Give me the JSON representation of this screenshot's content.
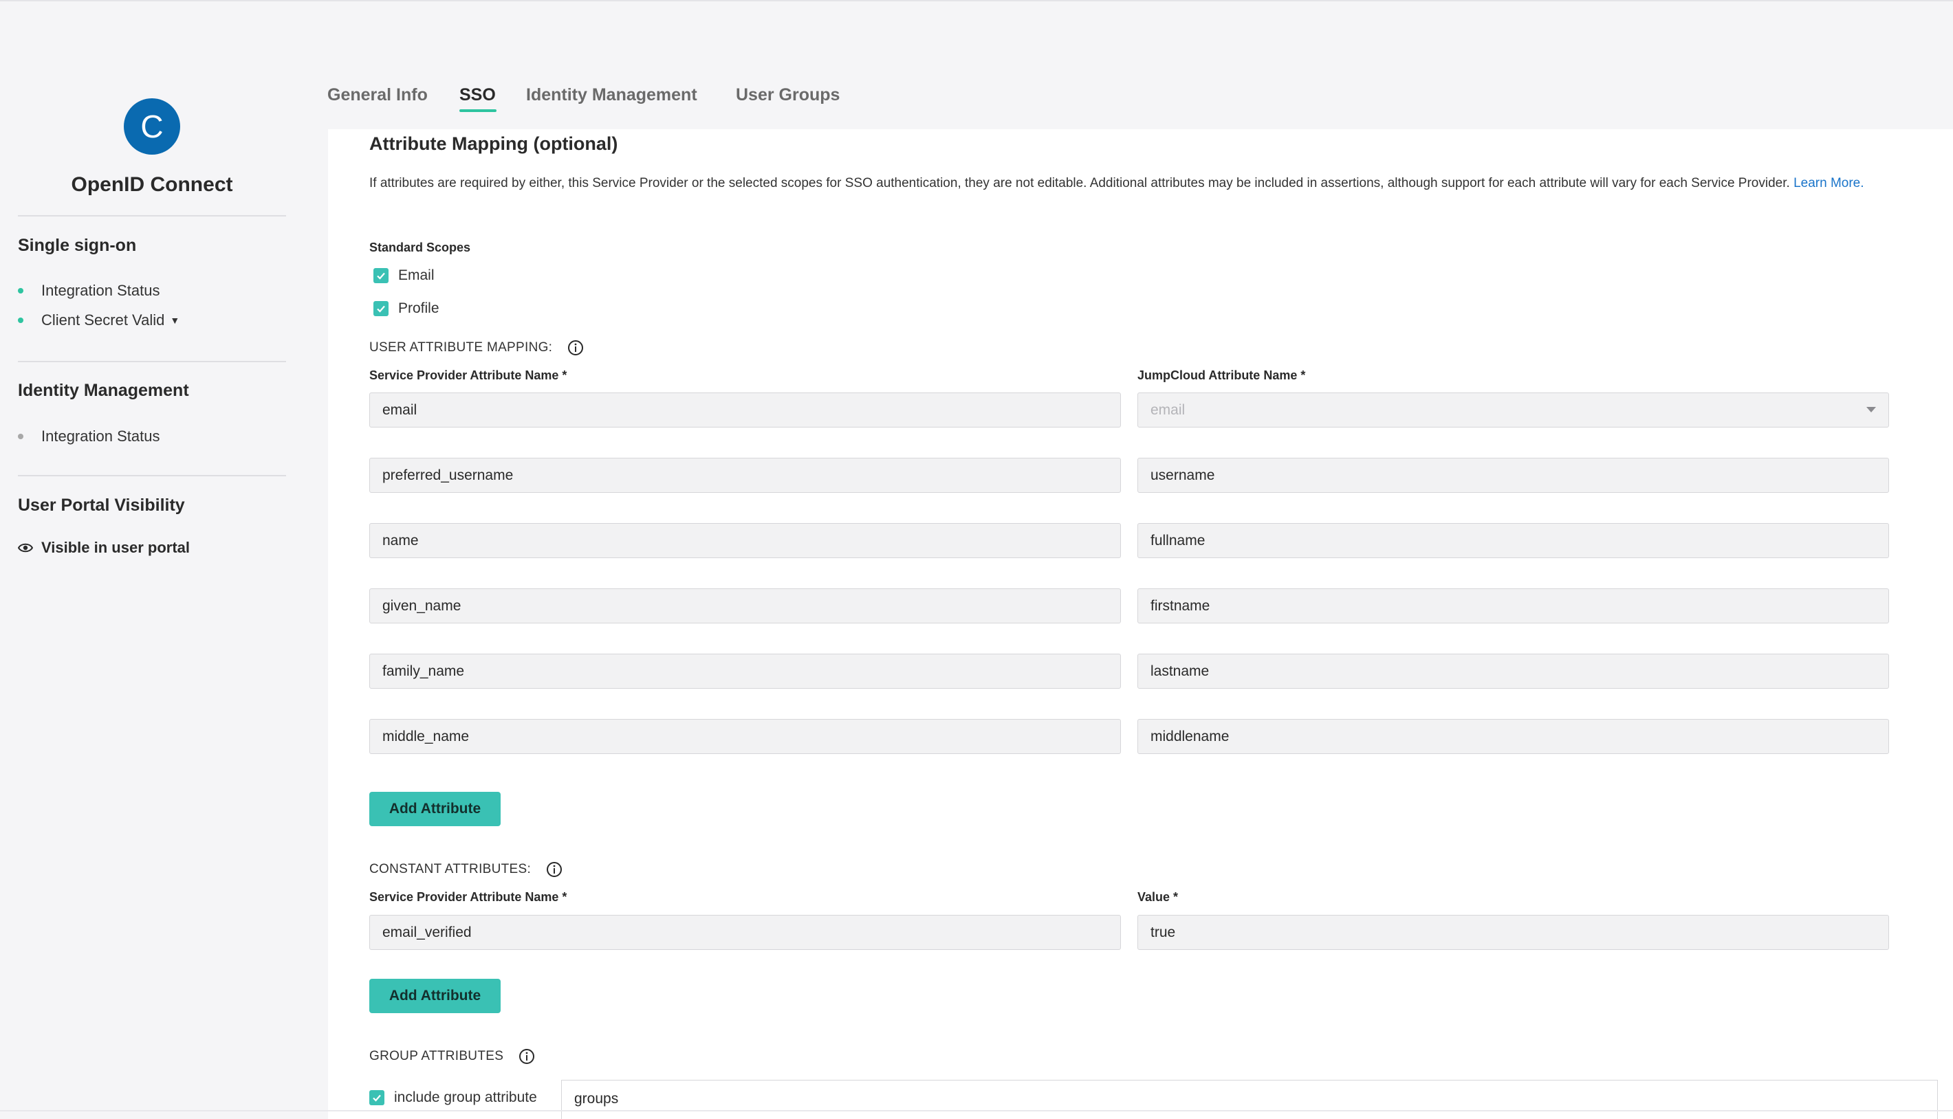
{
  "app": {
    "logo_letter": "C",
    "name": "OpenID Connect"
  },
  "sidebar": {
    "sso_title": "Single sign-on",
    "sso_items": [
      {
        "label": "Integration Status",
        "status": "green"
      },
      {
        "label": "Client Secret Valid",
        "status": "green"
      }
    ],
    "idm_title": "Identity Management",
    "idm_items": [
      {
        "label": "Integration Status",
        "status": "grey"
      }
    ],
    "portal_title": "User Portal Visibility",
    "portal_item": "Visible in user portal"
  },
  "tabs": [
    {
      "label": "General Info",
      "active": false
    },
    {
      "label": "SSO",
      "active": true
    },
    {
      "label": "Identity Management",
      "active": false
    },
    {
      "label": "User Groups",
      "active": false
    }
  ],
  "attribute_mapping": {
    "title": "Attribute Mapping (optional)",
    "description": "If attributes are required by either, this Service Provider or the selected scopes for SSO authentication, they are not editable. Additional attributes may be included in assertions, although support for each attribute will vary for each Service Provider.",
    "learn_more": "Learn More.",
    "standard_scopes_label": "Standard Scopes",
    "scopes": [
      {
        "label": "Email",
        "checked": true
      },
      {
        "label": "Profile",
        "checked": true
      }
    ],
    "user_mapping_label": "USER ATTRIBUTE MAPPING:",
    "sp_header": "Service Provider Attribute Name *",
    "jc_header": "JumpCloud Attribute Name *",
    "rows": [
      {
        "sp": "email",
        "jc": "email"
      },
      {
        "sp": "preferred_username",
        "jc": "username"
      },
      {
        "sp": "name",
        "jc": "fullname"
      },
      {
        "sp": "given_name",
        "jc": "firstname"
      },
      {
        "sp": "family_name",
        "jc": "lastname"
      },
      {
        "sp": "middle_name",
        "jc": "middlename"
      }
    ],
    "add_attribute": "Add Attribute"
  },
  "constant_attributes": {
    "label": "CONSTANT ATTRIBUTES:",
    "sp_header": "Service Provider Attribute Name *",
    "value_header": "Value *",
    "row": {
      "sp": "email_verified",
      "value": "true"
    },
    "add_attribute": "Add Attribute"
  },
  "group_attributes": {
    "label": "GROUP ATTRIBUTES",
    "include_label": "include group attribute",
    "include_checked": true,
    "value": "groups"
  },
  "colors": {
    "accent": "#3ac1b4",
    "logo": "#0a6ab0",
    "status_green": "#2ec4a0",
    "link": "#1a74c9"
  }
}
